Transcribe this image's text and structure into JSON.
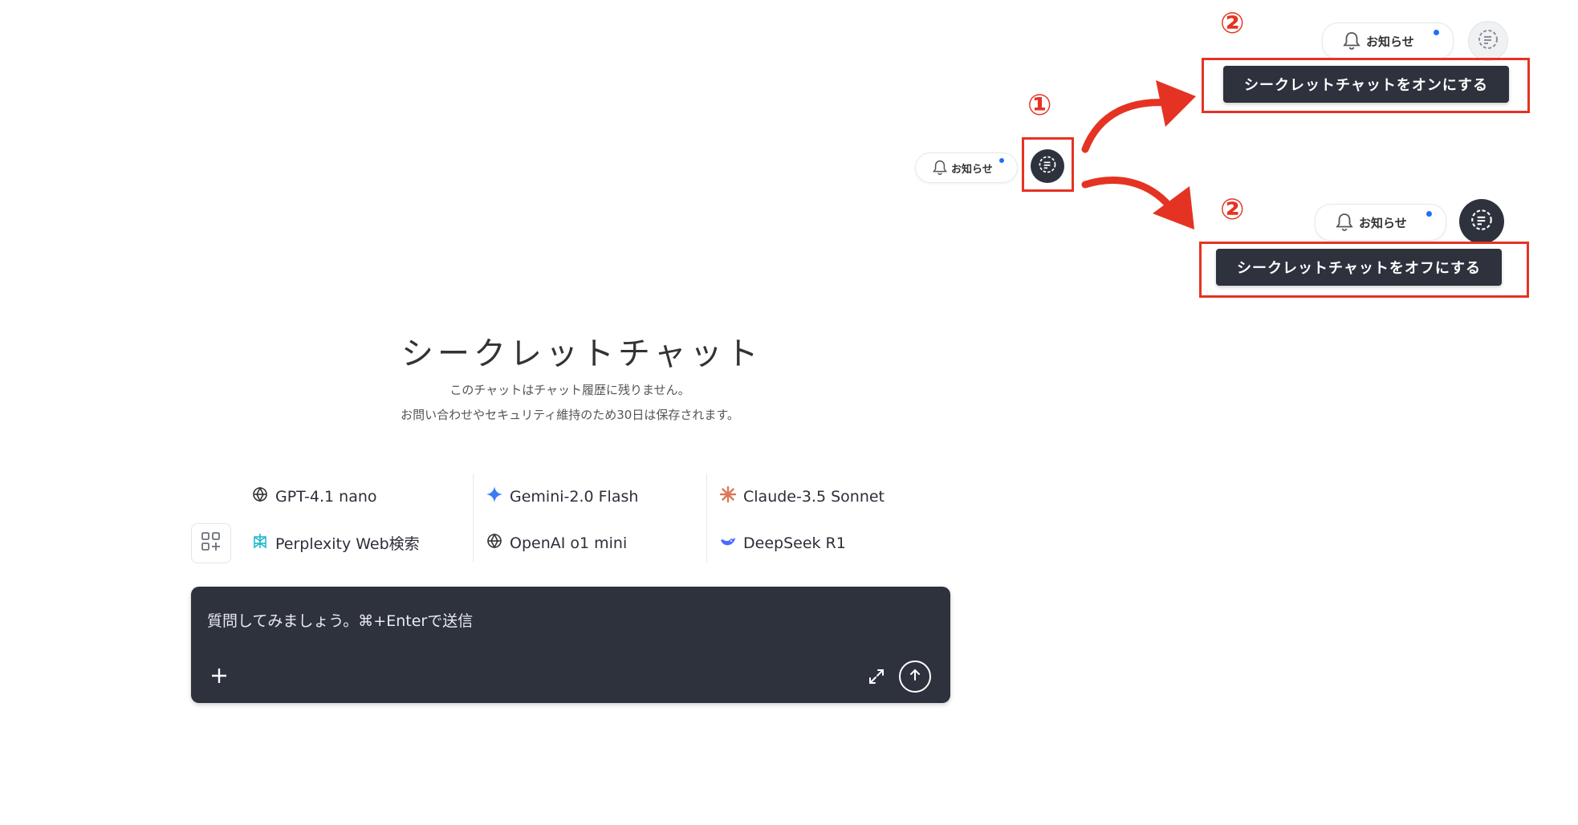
{
  "header": {
    "notification_label": "お知らせ"
  },
  "steps": {
    "one": "①",
    "two": "②"
  },
  "tooltips": {
    "turn_on": "シークレットチャットをオンにする",
    "turn_off": "シークレットチャットをオフにする"
  },
  "main": {
    "title": "シークレットチャット",
    "description_line1": "このチャットはチャット履歴に残りません。",
    "description_line2": "お問い合わせやセキュリティ維持のため30日は保存されます。"
  },
  "models": [
    {
      "label": "GPT-4.1 nano",
      "icon": "openai-icon"
    },
    {
      "label": "Gemini-2.0 Flash",
      "icon": "gemini-icon"
    },
    {
      "label": "Claude-3.5 Sonnet",
      "icon": "claude-icon"
    },
    {
      "label": "Perplexity Web検索",
      "icon": "perplexity-icon"
    },
    {
      "label": "OpenAI o1 mini",
      "icon": "openai-icon"
    },
    {
      "label": "DeepSeek R1",
      "icon": "deepseek-icon"
    }
  ],
  "input": {
    "placeholder": "質問してみましょう。⌘+Enterで送信"
  },
  "colors": {
    "dark": "#2d323d",
    "annotation_red": "#e53323",
    "notification_dot": "#1f6fff"
  }
}
